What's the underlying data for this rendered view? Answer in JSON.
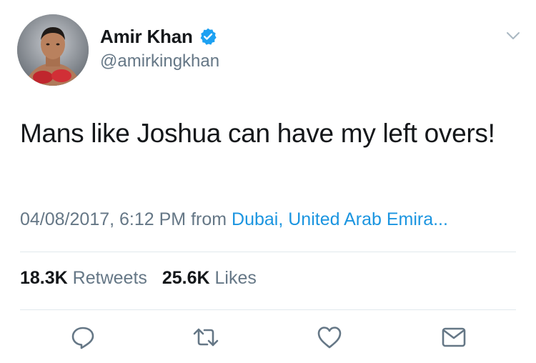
{
  "author": {
    "display_name": "Amir Khan",
    "handle": "@amirkingkhan",
    "verified": true,
    "avatar_icon": "profile-photo"
  },
  "tweet": {
    "text": "Mans like Joshua can have my left overs!",
    "timestamp": "04/08/2017, 6:12 PM",
    "from_label": "from",
    "location": "Dubai, United Arab Emira..."
  },
  "stats": {
    "retweets_count": "18.3K",
    "retweets_label": "Retweets",
    "likes_count": "25.6K",
    "likes_label": "Likes"
  },
  "icons": {
    "menu": "chevron-down-icon",
    "reply": "reply-icon",
    "retweet": "retweet-icon",
    "like": "heart-icon",
    "dm": "envelope-icon"
  },
  "colors": {
    "text_primary": "#14171a",
    "text_secondary": "#657786",
    "link": "#1b95e0",
    "verified": "#1da1f2",
    "divider": "#e1e8ed"
  }
}
